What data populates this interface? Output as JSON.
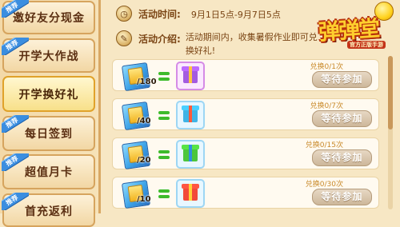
{
  "sidebar": {
    "badge_label": "推荐",
    "items": [
      {
        "label": "邀好友分现金",
        "badge": true,
        "active": false
      },
      {
        "label": "开学大作战",
        "badge": true,
        "active": false
      },
      {
        "label": "开学换好礼",
        "badge": false,
        "active": true
      },
      {
        "label": "每日签到",
        "badge": true,
        "active": false
      },
      {
        "label": "超值月卡",
        "badge": true,
        "active": false
      },
      {
        "label": "首充返利",
        "badge": true,
        "active": false
      }
    ]
  },
  "event": {
    "time_label": "活动时间:",
    "time_value": "9月1日5点-9月7日5点",
    "intro_label": "活动介绍:",
    "intro_value": "活动期间内，收集暑假作业即可兑换好礼!"
  },
  "logo": {
    "title": "弹弹堂",
    "subtitle": "官方正版手游"
  },
  "rewards": [
    {
      "quantity": "/180",
      "count": "兑换0/1次",
      "button": "等待参加",
      "gift": "purple",
      "gift_icon": "purple-gift-box-icon"
    },
    {
      "quantity": "/40",
      "count": "兑换0/7次",
      "button": "等待参加",
      "gift": "blue",
      "gift_icon": "blue-gift-box-icon"
    },
    {
      "quantity": "/20",
      "count": "兑换0/15次",
      "button": "等待参加",
      "gift": "green",
      "gift_icon": "green-gift-box-icon"
    },
    {
      "quantity": "/10",
      "count": "兑换0/30次",
      "button": "等待参加",
      "gift": "red",
      "gift_icon": "red-gift-box-icon"
    }
  ],
  "colors": {
    "accent": "#d9a864",
    "text_brown": "#7a4414",
    "button_disabled": "#cdb79a",
    "count_text": "#c98a2a"
  }
}
